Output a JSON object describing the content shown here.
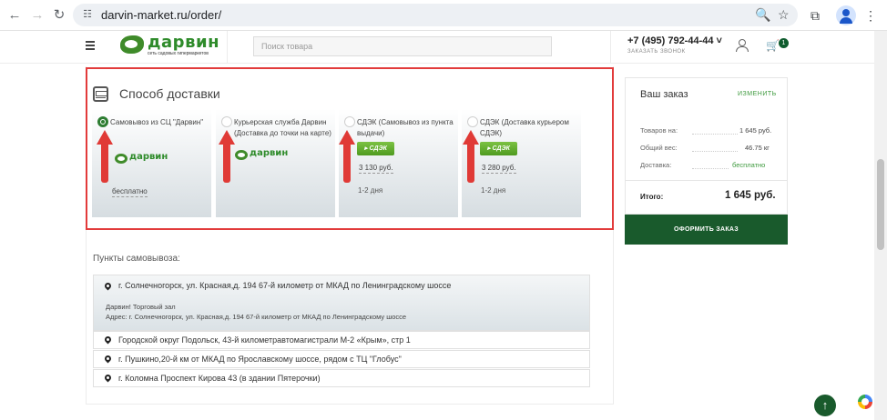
{
  "browser": {
    "url": "darvin-market.ru/order/",
    "back_icon": "back-arrow-icon",
    "forward_icon": "forward-arrow-icon",
    "reload_icon": "reload-icon"
  },
  "header": {
    "logo_word": "дарвин",
    "logo_tagline": "сеть садовых гипермаркетов",
    "search_placeholder": "Поиск товара",
    "phone": "+7 (495) 792-44-44",
    "callback": "ЗАКАЗАТЬ ЗВОНОК",
    "cart_count": "1"
  },
  "delivery": {
    "title": "Способ доставки",
    "options": [
      {
        "title": "Самовывоз из СЦ \"Дарвин\"",
        "logo": "дарвин",
        "price": "бесплатно",
        "selected": true
      },
      {
        "title": "Курьерская служба Дарвин (Доставка до точки на карте)",
        "logo": "дарвин",
        "selected": false
      },
      {
        "title": "СДЭК (Самовывоз из пункта выдачи)",
        "badge": "СДЭК",
        "price": "3 130 руб.",
        "days": "1-2 дня",
        "selected": false
      },
      {
        "title": "СДЭК (Доставка курьером СДЭК)",
        "badge": "СДЭК",
        "price": "3 280 руб.",
        "days": "1-2 дня",
        "selected": false
      }
    ]
  },
  "pickup": {
    "title": "Пункты самовывоза:",
    "active": {
      "address": "г. Солнечногорск, ул. Красная,д. 194 67-й километр от МКАД по Ленинградскому шоссе",
      "name": "Дарвин! Торговый зал",
      "full": "Адрес: г. Солнечногорск, ул. Красная,д. 194 67-й километр от МКАД по Ленинградскому шоссе"
    },
    "items": [
      "Городской округ Подольск, 43-й километравтомагистрали М-2 «Крым», стр 1",
      "г. Пушкино,20-й км от МКАД по Ярославскому шоссе, рядом с ТЦ \"Глобус\"",
      "г. Коломна Проспект Кирова 43 (в здании Пятерочки)"
    ]
  },
  "order": {
    "title": "Ваш заказ",
    "change": "ИЗМЕНИТЬ",
    "rows": [
      {
        "label": "Товаров на:",
        "value": "1 645 руб."
      },
      {
        "label": "Общий вес:",
        "value": "46.75 кг"
      },
      {
        "label": "Доставка:",
        "value": "бесплатно"
      }
    ],
    "total_label": "Итого:",
    "total_value": "1 645 руб.",
    "checkout": "ОФОРМИТЬ ЗАКАЗ"
  },
  "colors": {
    "accent": "#195a2c",
    "highlight": "#e23b3b",
    "free": "#3e9a3e"
  }
}
